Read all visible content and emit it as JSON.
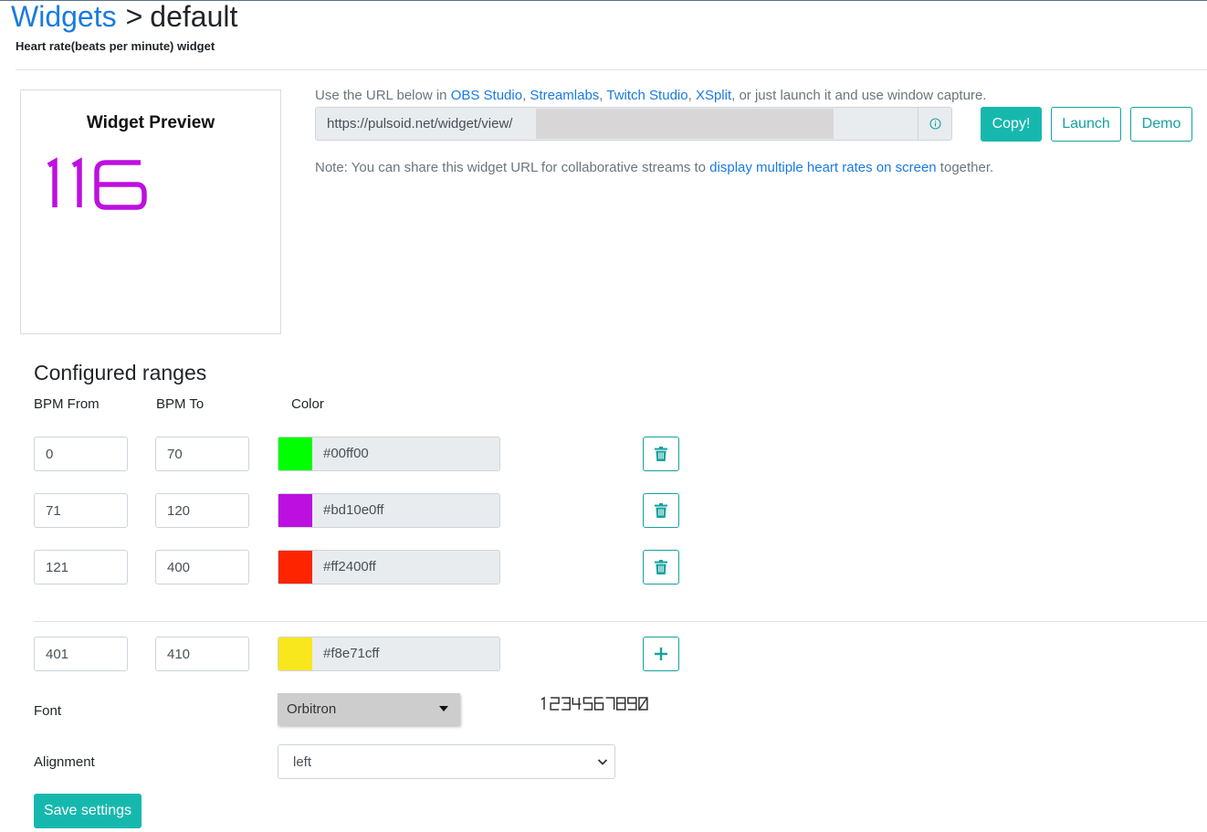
{
  "header": {
    "breadcrumb_link": "Widgets",
    "breadcrumb_sep": ">",
    "breadcrumb_current": "default",
    "subtitle": "Heart rate(beats per minute) widget"
  },
  "preview": {
    "title": "Widget Preview",
    "value": "116",
    "value_color": "#bd10e0"
  },
  "url_section": {
    "hint_prefix": "Use the URL below in ",
    "apps": [
      "OBS Studio",
      "Streamlabs",
      "Twitch Studio",
      "XSplit"
    ],
    "hint_suffix": ", or just launch it and use window capture.",
    "url": "https://pulsoid.net/widget/view/",
    "copy_label": "Copy!",
    "launch_label": "Launch",
    "demo_label": "Demo",
    "note_prefix": "Note: You can share this widget URL for collaborative streams to ",
    "note_link": "display multiple heart rates on screen",
    "note_suffix": " together."
  },
  "ranges": {
    "title": "Configured ranges",
    "col_from": "BPM From",
    "col_to": "BPM To",
    "col_color": "Color",
    "rows": [
      {
        "from": "0",
        "to": "70",
        "color": "#00ff00",
        "hex_label": "#00ff00"
      },
      {
        "from": "71",
        "to": "120",
        "color": "#bd10e0",
        "hex_label": "#bd10e0ff"
      },
      {
        "from": "121",
        "to": "400",
        "color": "#ff2400",
        "hex_label": "#ff2400ff"
      }
    ],
    "new_row": {
      "from": "401",
      "to": "410",
      "color": "#f8e71c",
      "hex_label": "#f8e71cff"
    }
  },
  "font": {
    "label": "Font",
    "selected": "Orbitron",
    "sample": "1234567890"
  },
  "alignment": {
    "label": "Alignment",
    "selected": "left"
  },
  "save_label": "Save settings",
  "colors": {
    "accent": "#16b8ae",
    "link": "#1a7be0"
  }
}
